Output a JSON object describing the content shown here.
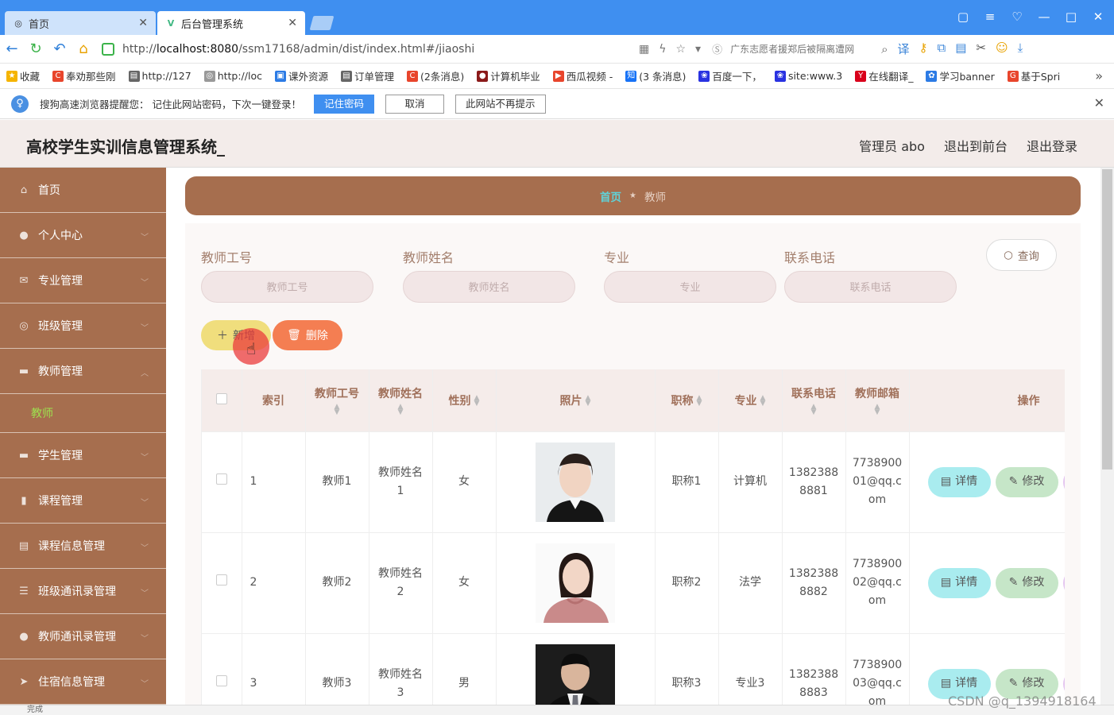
{
  "browser": {
    "tabs": [
      {
        "label": "首页"
      },
      {
        "label": "后台管理系统"
      }
    ],
    "url_prefix": "http://",
    "url_host": "localhost:8080",
    "url_path": "/ssm17168/admin/dist/index.html#/jiaoshi",
    "search_placeholder": "广东志愿者援郑后被隔离遭网",
    "bookmarks": [
      {
        "label": "收藏",
        "icon": "star-icon",
        "color": "#f5b400"
      },
      {
        "label": "奉劝那些刚",
        "icon": "c-icon",
        "color": "#e8452c"
      },
      {
        "label": "http://127",
        "icon": "doc-icon",
        "color": "#666666"
      },
      {
        "label": "http://loc",
        "icon": "globe-icon",
        "color": "#999999"
      },
      {
        "label": "课外资源",
        "icon": "bookmark-icon",
        "color": "#2c7be5"
      },
      {
        "label": "订单管理",
        "icon": "doc-icon",
        "color": "#666666"
      },
      {
        "label": "(2条消息)",
        "icon": "c-icon",
        "color": "#e8452c"
      },
      {
        "label": "计算机毕业",
        "icon": "avatar-icon",
        "color": "#8b1a1a"
      },
      {
        "label": "西瓜视频 -",
        "icon": "play-icon",
        "color": "#e8452c"
      },
      {
        "label": "(3 条消息)",
        "icon": "zhihu-icon",
        "color": "#1772f6"
      },
      {
        "label": "百度一下，",
        "icon": "paw-icon",
        "color": "#2932e1"
      },
      {
        "label": "site:www.3",
        "icon": "paw-icon",
        "color": "#2932e1"
      },
      {
        "label": "在线翻译_",
        "icon": "y-icon",
        "color": "#d9001b"
      },
      {
        "label": "学习banner",
        "icon": "flower-icon",
        "color": "#2c7be5"
      },
      {
        "label": "基于Spri",
        "icon": "g-icon",
        "color": "#e8452c"
      }
    ],
    "more_label": "»"
  },
  "notice": {
    "text": "搜狗高速浏览器提醒您： 记住此网站密码，下次一键登录！",
    "remember_label": "记住密码",
    "cancel_label": "取消",
    "never_label": "此网站不再提示"
  },
  "app": {
    "title": "高校学生实训信息管理系统_",
    "admin_label": "管理员 abo",
    "front_label": "退出到前台",
    "logout_label": "退出登录"
  },
  "sidebar": {
    "items": [
      {
        "label": "首页",
        "icon": "home-icon"
      },
      {
        "label": "个人中心",
        "icon": "user-icon"
      },
      {
        "label": "专业管理",
        "icon": "mail-icon"
      },
      {
        "label": "班级管理",
        "icon": "circle-icon"
      },
      {
        "label": "教师管理",
        "icon": "monitor-icon"
      },
      {
        "label": "学生管理",
        "icon": "monitor-icon"
      },
      {
        "label": "课程管理",
        "icon": "mic-icon"
      },
      {
        "label": "课程信息管理",
        "icon": "clipboard-icon"
      },
      {
        "label": "班级通讯录管理",
        "icon": "list-icon"
      },
      {
        "label": "教师通讯录管理",
        "icon": "user-icon"
      },
      {
        "label": "住宿信息管理",
        "icon": "send-icon"
      }
    ],
    "active_sub": "教师"
  },
  "breadcrumb": {
    "home": "首页",
    "current": "教师"
  },
  "filters": {
    "gonghao": {
      "label": "教师工号",
      "placeholder": "教师工号"
    },
    "xingming": {
      "label": "教师姓名",
      "placeholder": "教师姓名"
    },
    "zhuanye": {
      "label": "专业",
      "placeholder": "专业"
    },
    "dianhua": {
      "label": "联系电话",
      "placeholder": "联系电话"
    },
    "query_label": "查询"
  },
  "actions": {
    "add_label": "新增",
    "delete_label": "删除"
  },
  "table": {
    "headers": {
      "index": "索引",
      "gonghao": "教师工号",
      "xingming": "教师姓名",
      "xingbie": "性别",
      "zhaopian": "照片",
      "zhicheng": "职称",
      "zhuanye": "专业",
      "dianhua": "联系电话",
      "youxiang": "教师邮箱",
      "op": "操作"
    },
    "rows": [
      {
        "index": "1",
        "gonghao": "教师1",
        "xingming": "教师姓名1",
        "xingbie": "女",
        "zhicheng": "职称1",
        "zhuanye": "计算机",
        "dianhua": "13823888881",
        "youxiang": "773890001@qq.com"
      },
      {
        "index": "2",
        "gonghao": "教师2",
        "xingming": "教师姓名2",
        "xingbie": "女",
        "zhicheng": "职称2",
        "zhuanye": "法学",
        "dianhua": "13823888882",
        "youxiang": "773890002@qq.com"
      },
      {
        "index": "3",
        "gonghao": "教师3",
        "xingming": "教师姓名3",
        "xingbie": "男",
        "zhicheng": "职称3",
        "zhuanye": "专业3",
        "dianhua": "13823888883",
        "youxiang": "773890003@qq.com"
      }
    ],
    "detail_label": "详情",
    "edit_label": "修改"
  },
  "status": {
    "text": "完成"
  },
  "watermark": "CSDN @q_1394918164"
}
